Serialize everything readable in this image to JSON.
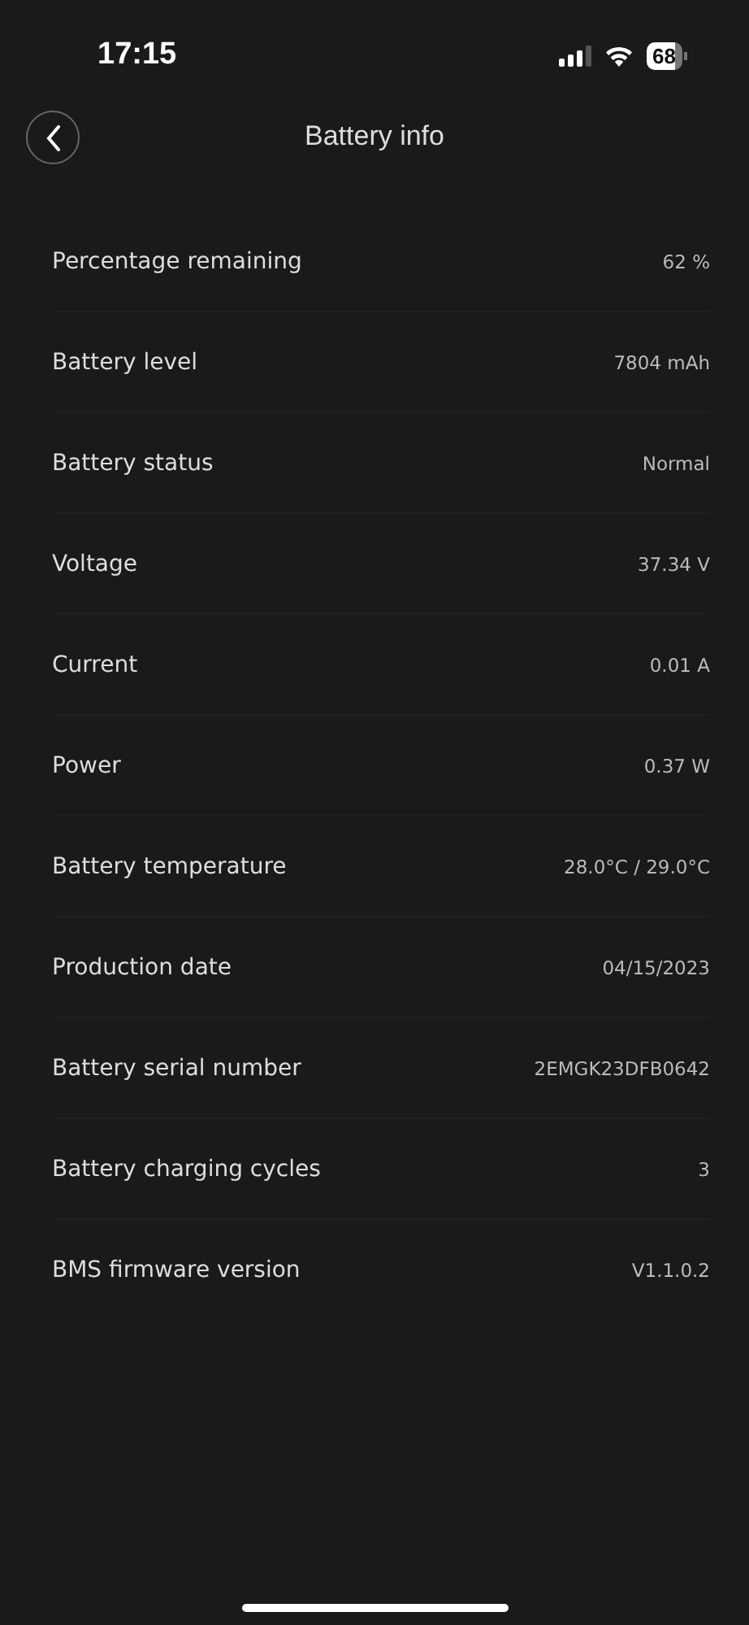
{
  "status_bar": {
    "time": "17:15",
    "battery": "68"
  },
  "header": {
    "title": "Battery info"
  },
  "rows": [
    {
      "label": "Percentage remaining",
      "value": "62 %"
    },
    {
      "label": "Battery level",
      "value": "7804 mAh"
    },
    {
      "label": "Battery status",
      "value": "Normal"
    },
    {
      "label": "Voltage",
      "value": "37.34 V"
    },
    {
      "label": "Current",
      "value": "0.01 A"
    },
    {
      "label": "Power",
      "value": "0.37 W"
    },
    {
      "label": "Battery temperature",
      "value": "28.0°C / 29.0°C"
    },
    {
      "label": "Production date",
      "value": "04/15/2023"
    },
    {
      "label": "Battery serial number",
      "value": "2EMGK23DFB0642"
    },
    {
      "label": "Battery charging cycles",
      "value": "3"
    },
    {
      "label": "BMS firmware version",
      "value": "V1.1.0.2"
    }
  ]
}
